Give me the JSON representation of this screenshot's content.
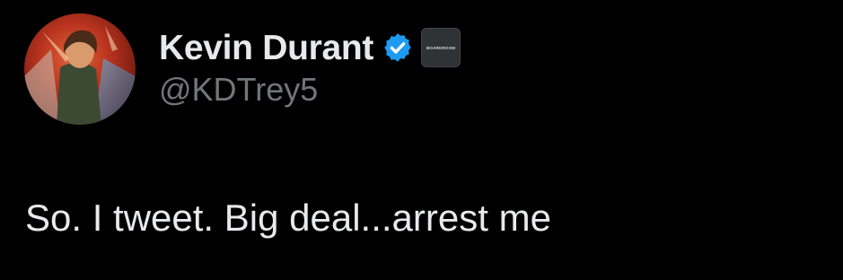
{
  "author": {
    "display_name": "Kevin Durant",
    "handle": "@KDTrey5",
    "verified_icon": "verified-badge-icon",
    "affiliate_badge_text": "BOARDROOM"
  },
  "tweet": {
    "text": "So. I tweet. Big deal...arrest me"
  },
  "colors": {
    "background": "#000000",
    "primary_text": "#e7e9ea",
    "secondary_text": "#71767b",
    "verified_blue": "#1d9bf0"
  }
}
